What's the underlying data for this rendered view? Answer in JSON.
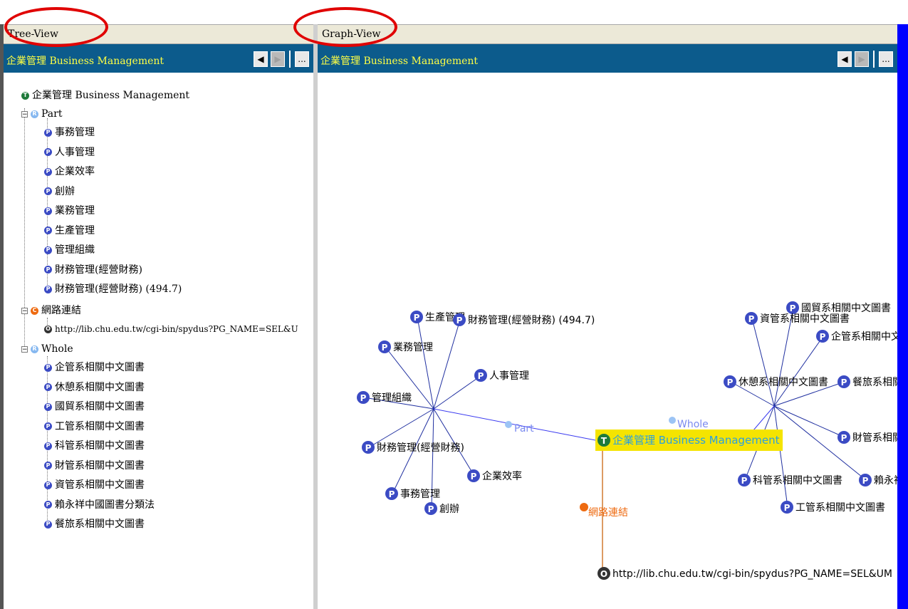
{
  "tree_view": {
    "title": "Tree-View",
    "header_title": "企業管理 Business Management",
    "root": "企業管理 Business Management",
    "part_label": "Part",
    "part_items": [
      "事務管理",
      "人事管理",
      "企業效率",
      "創辦",
      "業務管理",
      "生產管理",
      "管理組織",
      "財務管理(經營財務)",
      "財務管理(經營財務) (494.7)"
    ],
    "web_label": "網路連結",
    "web_url": "http://lib.chu.edu.tw/cgi-bin/spydus?PG_NAME=SEL&U",
    "whole_label": "Whole",
    "whole_items": [
      "企管系相關中文圖書",
      "休憩系相關中文圖書",
      "國貿系相關中文圖書",
      "工管系相關中文圖書",
      "科管系相關中文圖書",
      "財管系相關中文圖書",
      "資管系相關中文圖書",
      "賴永祥中國圖書分類法",
      "餐旅系相關中文圖書"
    ]
  },
  "graph_view": {
    "title": "Graph-View",
    "header_title": "企業管理 Business Management",
    "center": "企業管理 Business Management",
    "part_label": "Part",
    "whole_label": "Whole",
    "web_label": "網路連結",
    "url_label": "http://lib.chu.edu.tw/cgi-bin/spydus?PG_NAME=SEL&UM",
    "part_nodes": [
      "生產管理",
      "財務管理(經營財務) (494.7)",
      "業務管理",
      "人事管理",
      "管理組織",
      "財務管理(經營財務)",
      "企業效率",
      "事務管理",
      "創辦"
    ],
    "whole_nodes": [
      "國貿系相關中文圖書",
      "資管系相關中文圖書",
      "企管系相關中文圖書",
      "休憩系相關中文圖書",
      "餐旅系相關中文圖書",
      "財管系相關中文圖書",
      "科管系相關中文圖書",
      "賴永祥中國圖書分類法",
      "工管系相關中文圖書"
    ]
  },
  "nav": {
    "back": "◀",
    "forward": "▶",
    "more": "..."
  },
  "colors": {
    "header_bg": "#0c5b8c",
    "header_text": "#ffff44",
    "center_highlight": "#f5e400",
    "link_line": "#3a3af0",
    "web_line": "#d07a30",
    "annotation": "#e00000"
  }
}
